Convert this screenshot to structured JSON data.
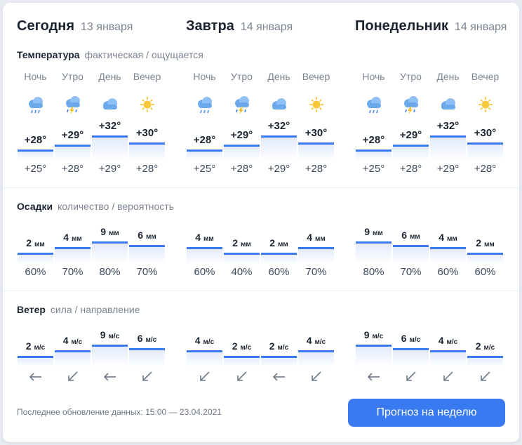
{
  "days": [
    {
      "name": "Сегодня",
      "date": "13 января",
      "periods": [
        "Ночь",
        "Утро",
        "День",
        "Вечер"
      ],
      "icons": [
        "cloud-rain-icon",
        "cloud-thunder-icon",
        "cloud-icon",
        "sun-icon"
      ],
      "temp_actual": [
        "+28°",
        "+29°",
        "+32°",
        "+30°"
      ],
      "temp_feels": [
        "+25°",
        "+28°",
        "+29°",
        "+28°"
      ],
      "precip_amount": [
        "2",
        "4",
        "9",
        "6"
      ],
      "precip_prob": [
        "60%",
        "70%",
        "80%",
        "70%"
      ],
      "wind_speed": [
        "2",
        "4",
        "9",
        "6"
      ],
      "wind_dir": [
        "arrow-left-icon",
        "arrow-down-left-icon",
        "arrow-left-icon",
        "arrow-down-left-icon"
      ]
    },
    {
      "name": "Завтра",
      "date": "14 января",
      "periods": [
        "Ночь",
        "Утро",
        "День",
        "Вечер"
      ],
      "icons": [
        "cloud-rain-icon",
        "cloud-thunder-icon",
        "cloud-icon",
        "sun-icon"
      ],
      "temp_actual": [
        "+28°",
        "+29°",
        "+32°",
        "+30°"
      ],
      "temp_feels": [
        "+25°",
        "+28°",
        "+29°",
        "+28°"
      ],
      "precip_amount": [
        "4",
        "2",
        "2",
        "4"
      ],
      "precip_prob": [
        "60%",
        "40%",
        "60%",
        "70%"
      ],
      "wind_speed": [
        "4",
        "2",
        "2",
        "4"
      ],
      "wind_dir": [
        "arrow-down-left-icon",
        "arrow-down-left-icon",
        "arrow-left-icon",
        "arrow-down-left-icon"
      ]
    },
    {
      "name": "Понедельник",
      "date": "14 января",
      "periods": [
        "Ночь",
        "Утро",
        "День",
        "Вечер"
      ],
      "icons": [
        "cloud-rain-icon",
        "cloud-thunder-icon",
        "cloud-icon",
        "sun-icon"
      ],
      "temp_actual": [
        "+28°",
        "+29°",
        "+32°",
        "+30°"
      ],
      "temp_feels": [
        "+25°",
        "+28°",
        "+29°",
        "+28°"
      ],
      "precip_amount": [
        "9",
        "6",
        "4",
        "2"
      ],
      "precip_prob": [
        "80%",
        "70%",
        "60%",
        "60%"
      ],
      "wind_speed": [
        "9",
        "6",
        "4",
        "2"
      ],
      "wind_dir": [
        "arrow-left-icon",
        "arrow-down-left-icon",
        "arrow-down-left-icon",
        "arrow-down-left-icon"
      ]
    }
  ],
  "sections": {
    "temperature": {
      "title": "Температура",
      "subtitle": "фактическая / ощущается"
    },
    "precipitation": {
      "title": "Осадки",
      "subtitle": "количество / вероятность",
      "unit": "мм"
    },
    "wind": {
      "title": "Ветер",
      "subtitle": "сила / направление",
      "unit": "м/с"
    }
  },
  "footer": {
    "updated": "Последнее обновление данных: 15:00 — 23.04.2021"
  },
  "button": {
    "label": "Прогноз на неделю"
  },
  "colors": {
    "accent": "#3a7af0",
    "sun": "#f5c22e",
    "cloud": "#6ba8ec",
    "rain": "#4a88e8"
  }
}
